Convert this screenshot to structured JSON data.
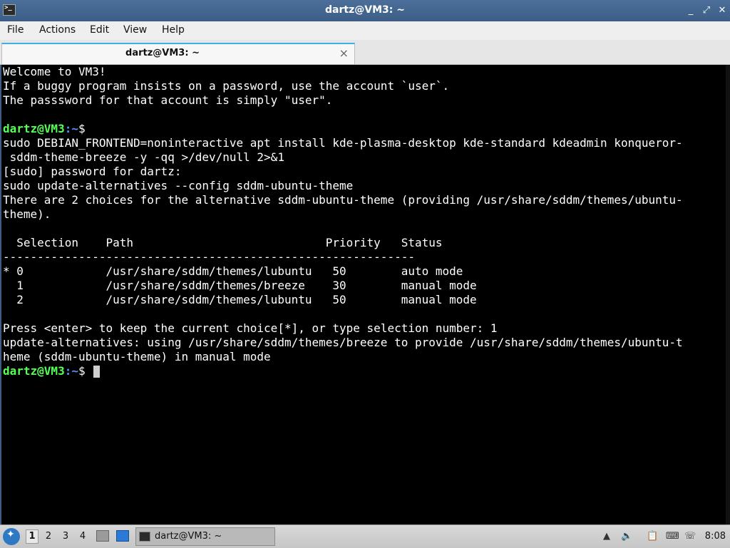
{
  "window": {
    "title": "dartz@VM3: ~",
    "minimize": "_",
    "restore": "⤢",
    "close": "✕"
  },
  "menu": {
    "file": "File",
    "actions": "Actions",
    "edit": "Edit",
    "view": "View",
    "help": "Help"
  },
  "tab": {
    "label": "dartz@VM3: ~",
    "close": "×"
  },
  "terminal": {
    "prompt_user": "dartz@VM3",
    "prompt_path": ":~",
    "prompt_sign": "$",
    "lines": [
      "Welcome to VM3!",
      "If a buggy program insists on a password, use the account `user`.",
      "The passsword for that account is simply \"user\".",
      "",
      "",
      "sudo DEBIAN_FRONTEND=noninteractive apt install kde-plasma-desktop kde-standard kdeadmin konqueror-",
      " sddm-theme-breeze -y -qq >/dev/null 2>&1",
      "[sudo] password for dartz:",
      "sudo update-alternatives --config sddm-ubuntu-theme",
      "There are 2 choices for the alternative sddm-ubuntu-theme (providing /usr/share/sddm/themes/ubuntu-",
      "theme).",
      "",
      "  Selection    Path                            Priority   Status",
      "------------------------------------------------------------",
      "* 0            /usr/share/sddm/themes/lubuntu   50        auto mode",
      "  1            /usr/share/sddm/themes/breeze    30        manual mode",
      "  2            /usr/share/sddm/themes/lubuntu   50        manual mode",
      "",
      "Press <enter> to keep the current choice[*], or type selection number: 1",
      "update-alternatives: using /usr/share/sddm/themes/breeze to provide /usr/share/sddm/themes/ubuntu-t",
      "heme (sddm-ubuntu-theme) in manual mode"
    ]
  },
  "taskbar": {
    "workspaces": [
      "1",
      "2",
      "3",
      "4"
    ],
    "active_workspace": "1",
    "task_label": "dartz@VM3: ~",
    "clock": "8:08"
  },
  "colors": {
    "prompt_user": "#55ff55",
    "prompt_path": "#5d8fff",
    "titlebar": "#3c5e86"
  }
}
